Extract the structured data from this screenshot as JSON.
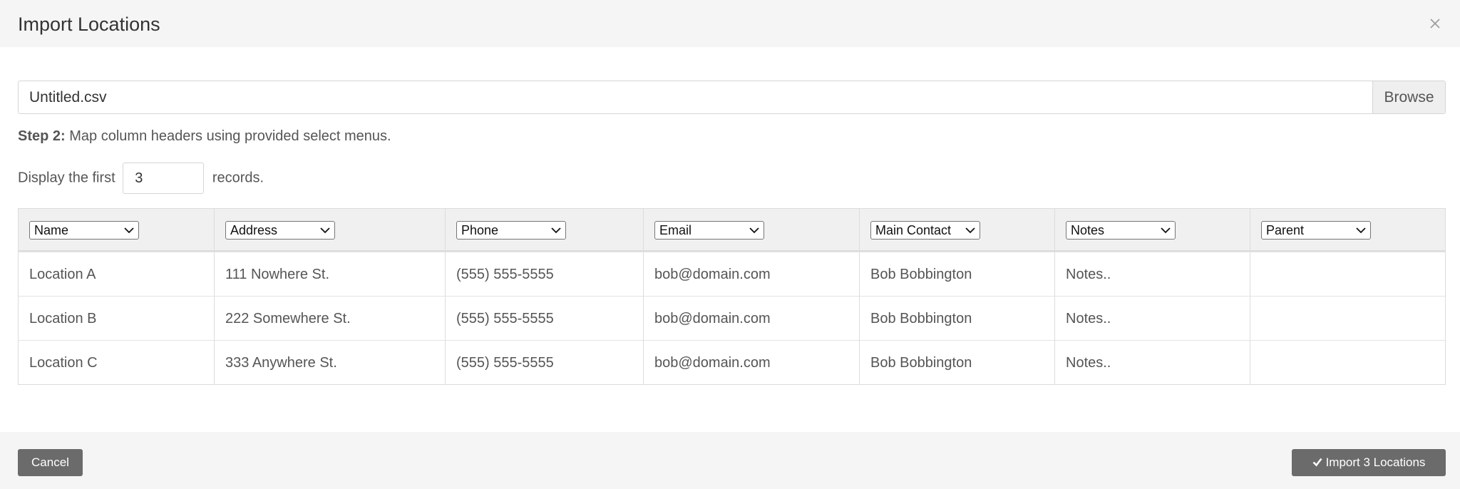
{
  "modal": {
    "title": "Import Locations"
  },
  "file": {
    "name": "Untitled.csv",
    "browse_label": "Browse"
  },
  "step": {
    "bold": "Step 2:",
    "text": "Map column headers using provided select menus."
  },
  "display": {
    "prefix": "Display the first",
    "count": "3",
    "suffix": "records."
  },
  "columns": [
    "Name",
    "Address",
    "Phone",
    "Email",
    "Main Contact",
    "Notes",
    "Parent"
  ],
  "rows": [
    [
      "Location A",
      "111 Nowhere St.",
      "(555) 555-5555",
      "bob@domain.com",
      "Bob Bobbington",
      "Notes..",
      ""
    ],
    [
      "Location B",
      "222 Somewhere St.",
      "(555) 555-5555",
      "bob@domain.com",
      "Bob Bobbington",
      "Notes..",
      ""
    ],
    [
      "Location C",
      "333 Anywhere St.",
      "(555) 555-5555",
      "bob@domain.com",
      "Bob Bobbington",
      "Notes..",
      ""
    ]
  ],
  "footer": {
    "cancel_label": "Cancel",
    "import_label": "Import 3 Locations"
  },
  "icons": {
    "close": "close-icon",
    "check": "check-icon",
    "chevron": "chevron-down-icon"
  }
}
